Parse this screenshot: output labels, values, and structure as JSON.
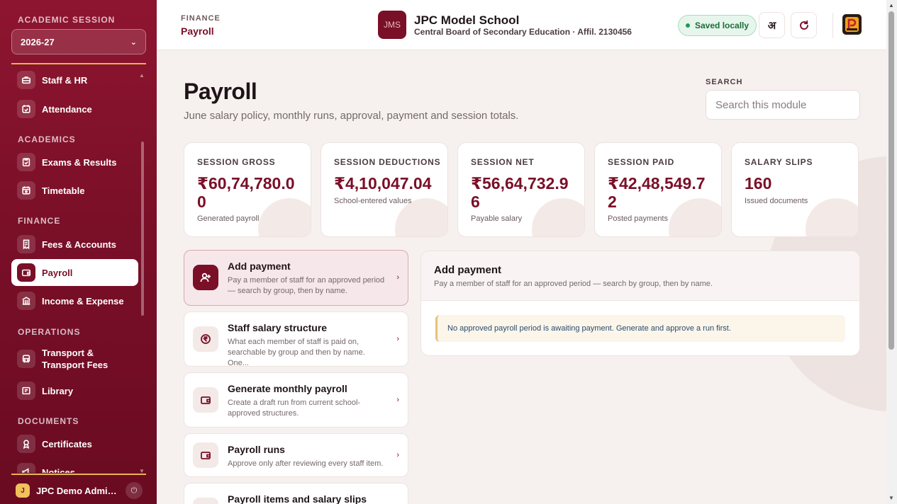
{
  "sidebar": {
    "session_label": "ACADEMIC SESSION",
    "session_value": "2026-27",
    "sections": {
      "academics": "ACADEMICS",
      "finance": "FINANCE",
      "operations": "OPERATIONS",
      "documents": "DOCUMENTS"
    },
    "items": [
      {
        "label": "Staff & HR",
        "icon": "briefcase-icon"
      },
      {
        "label": "Attendance",
        "icon": "calendar-check-icon"
      },
      {
        "label": "Exams & Results",
        "icon": "clipboard-icon"
      },
      {
        "label": "Timetable",
        "icon": "calendar-icon"
      },
      {
        "label": "Fees & Accounts",
        "icon": "receipt-icon"
      },
      {
        "label": "Payroll",
        "icon": "wallet-icon",
        "active": true
      },
      {
        "label": "Income & Expense",
        "icon": "bank-icon"
      },
      {
        "label": "Transport & Transport Fees",
        "icon": "bus-icon"
      },
      {
        "label": "Library",
        "icon": "book-icon"
      },
      {
        "label": "Certificates",
        "icon": "award-icon"
      },
      {
        "label": "Notices",
        "icon": "megaphone-icon"
      }
    ],
    "user": {
      "initial": "J",
      "name": "JPC Demo Administrator"
    }
  },
  "topbar": {
    "crumb_section": "FINANCE",
    "crumb_page": "Payroll",
    "school_initials": "JMS",
    "school_name": "JPC Model School",
    "school_board": "Central Board of Secondary Education · Affil. 2130456",
    "status_badge": "Saved locally",
    "language_toggle": "अ",
    "refresh_icon": "refresh-icon"
  },
  "page": {
    "title": "Payroll",
    "subtitle": "June salary policy, monthly runs, approval, payment and session totals.",
    "search_label": "SEARCH",
    "search_placeholder": "Search this module"
  },
  "stats": [
    {
      "label": "SESSION GROSS",
      "value": "₹60,74,780.00",
      "note": "Generated payroll"
    },
    {
      "label": "SESSION DEDUCTIONS",
      "value": "₹4,10,047.04",
      "note": "School-entered values"
    },
    {
      "label": "SESSION NET",
      "value": "₹56,64,732.96",
      "note": "Payable salary"
    },
    {
      "label": "SESSION PAID",
      "value": "₹42,48,549.72",
      "note": "Posted payments"
    },
    {
      "label": "SALARY SLIPS",
      "value": "160",
      "note": "Issued documents"
    }
  ],
  "actions": [
    {
      "title": "Add payment",
      "desc": "Pay a member of staff for an approved period — search by group, then by name.",
      "icon": "user-plus-icon",
      "active": true
    },
    {
      "title": "Staff salary structure",
      "desc": "What each member of staff is paid on, searchable by group and then by name. One...",
      "icon": "rupee-icon"
    },
    {
      "title": "Generate monthly payroll",
      "desc": "Create a draft run from current school-approved structures.",
      "icon": "wallet-icon"
    },
    {
      "title": "Payroll runs",
      "desc": "Approve only after reviewing every staff item.",
      "icon": "wallet-icon"
    },
    {
      "title": "Payroll items and salary slips",
      "desc": "",
      "icon": "document-icon"
    }
  ],
  "panel": {
    "title": "Add payment",
    "desc": "Pay a member of staff for an approved period — search by group, then by name.",
    "alert": "No approved payroll period is awaiting payment. Generate and approve a run first."
  },
  "colors": {
    "brand": "#7a0f28",
    "accent_gold": "#e9b54a",
    "success": "#1f9a4f"
  }
}
